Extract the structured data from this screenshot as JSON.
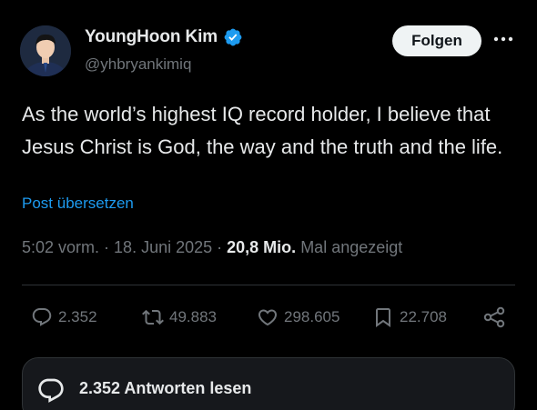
{
  "author": {
    "name": "YoungHoon Kim",
    "handle": "@yhbryankimiq",
    "verified_icon": "verified-badge-icon",
    "verified_color": "#1d9bf0"
  },
  "header": {
    "follow_label": "Folgen",
    "more_icon": "more-horizontal-icon"
  },
  "tweet": {
    "text": "As the world’s highest IQ record holder, I believe that Jesus Christ is God, the way and the truth and the life.",
    "translate_label": "Post übersetzen"
  },
  "meta": {
    "time": "5:02 vorm.",
    "separator": " · ",
    "date": "18. Juni 2025",
    "views_count": "20,8 Mio.",
    "views_label": "Mal angezeigt"
  },
  "actions": {
    "replies": "2.352",
    "retweets": "49.883",
    "likes": "298.605",
    "bookmarks": "22.708"
  },
  "replies_bar": {
    "label": "2.352 Antworten lesen"
  },
  "colors": {
    "background": "#000000",
    "text_primary": "#e7e9ea",
    "text_secondary": "#71767b",
    "link": "#1d9bf0",
    "follow_button_bg": "#eff3f4",
    "divider": "#2f3336"
  }
}
